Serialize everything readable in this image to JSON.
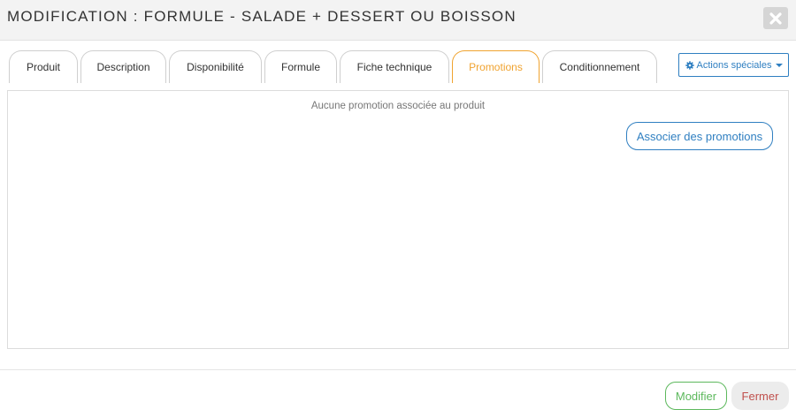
{
  "header": {
    "title": "MODIFICATION : FORMULE - SALADE + DESSERT OU BOISSON",
    "close_icon": "close-x-icon"
  },
  "tabs": [
    {
      "label": "Produit",
      "active": false
    },
    {
      "label": "Description",
      "active": false
    },
    {
      "label": "Disponibilité",
      "active": false
    },
    {
      "label": "Formule",
      "active": false
    },
    {
      "label": "Fiche technique",
      "active": false
    },
    {
      "label": "Promotions",
      "active": true
    },
    {
      "label": "Conditionnement",
      "active": false
    }
  ],
  "actions": {
    "label": "Actions spéciales",
    "icon": "gear-icon"
  },
  "panel": {
    "empty_message": "Aucune promotion associée au produit",
    "associate_label": "Associer des promotions"
  },
  "footer": {
    "modify_label": "Modifier",
    "close_label": "Fermer"
  },
  "colors": {
    "accent_blue": "#2f7fc1",
    "active_tab": "#f0a330",
    "success_green": "#5cb85c",
    "danger_red": "#c0504d"
  }
}
